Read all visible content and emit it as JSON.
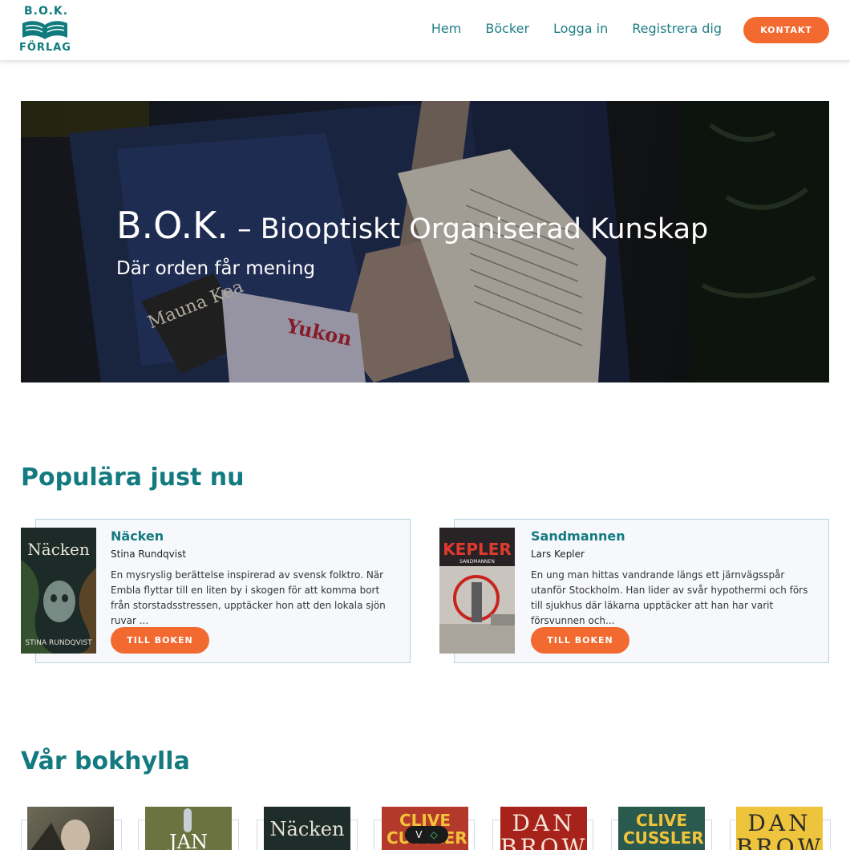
{
  "logo": {
    "top": "B.O.K.",
    "bottom": "FÖRLAG"
  },
  "nav": {
    "items": [
      "Hem",
      "Böcker",
      "Logga in",
      "Registrera dig"
    ],
    "contact": "KONTAKT"
  },
  "hero": {
    "title_strong": "B.O.K.",
    "title_rest": " – Biooptiskt Organiserad Kunskap",
    "subtitle": "Där orden får mening",
    "book_text": [
      "Mauna Kea",
      "Yukon"
    ]
  },
  "popular": {
    "heading": "Populära just nu",
    "books": [
      {
        "title": "Näcken",
        "author": "Stina Rundqvist",
        "description": "En mysryslig berättelse inspirerad av svensk folktro. När Embla flyttar till en liten by i skogen för att komma bort från storstadsstressen, upptäcker hon att den lokala sjön ruvar ...",
        "button": "TILL BOKEN",
        "cover_title": "Näcken",
        "cover_author": "STINA RUNDQVIST"
      },
      {
        "title": "Sandmannen",
        "author": "Lars Kepler",
        "description": "En ung man hittas vandrande längs ett järnvägsspår utanför Stockholm. Han lider av svår hypothermi och förs till sjukhus där läkarna upptäcker att han har varit försvunnen och...",
        "button": "TILL BOKEN",
        "cover_title": "KEPLER",
        "cover_subtitle": "SANDMANNEN"
      }
    ]
  },
  "shelf": {
    "heading": "Vår bokhylla",
    "labels": [
      "",
      "JAN",
      "Näcken",
      "CLIVE CUSSLER",
      "DAN BROWN",
      "CLIVE CUSSLER",
      "DAN BROWN"
    ],
    "scroll_pill": [
      "V",
      "◇"
    ]
  },
  "colors": {
    "accent": "#f26a30",
    "brand": "#137a80",
    "card_bg": "#f6f8fc"
  }
}
